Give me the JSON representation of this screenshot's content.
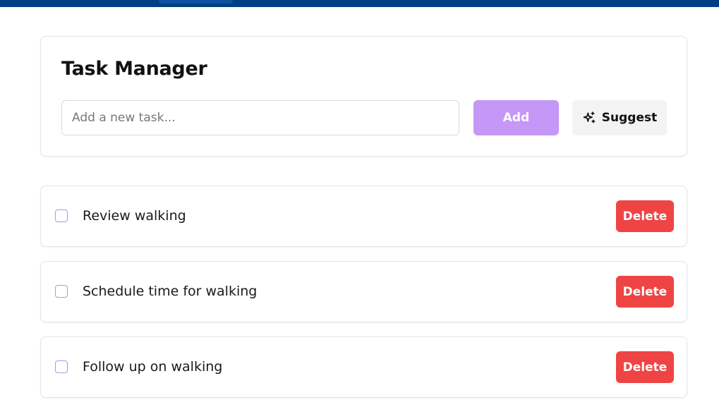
{
  "app": {
    "title": "Task Manager"
  },
  "new_task": {
    "placeholder": "Add a new task...",
    "value": "",
    "add_label": "Add",
    "suggest_label": "Suggest",
    "suggest_icon": "sparkles-icon"
  },
  "tasks": [
    {
      "text": "Review walking",
      "completed": false,
      "delete_label": "Delete"
    },
    {
      "text": "Schedule time for walking",
      "completed": false,
      "delete_label": "Delete"
    },
    {
      "text": "Follow up on walking",
      "completed": false,
      "delete_label": "Delete"
    }
  ],
  "colors": {
    "topbar": "#003e84",
    "accent": "#c597f6",
    "danger": "#ef4444",
    "checkbox_border": "#b98fe8"
  }
}
